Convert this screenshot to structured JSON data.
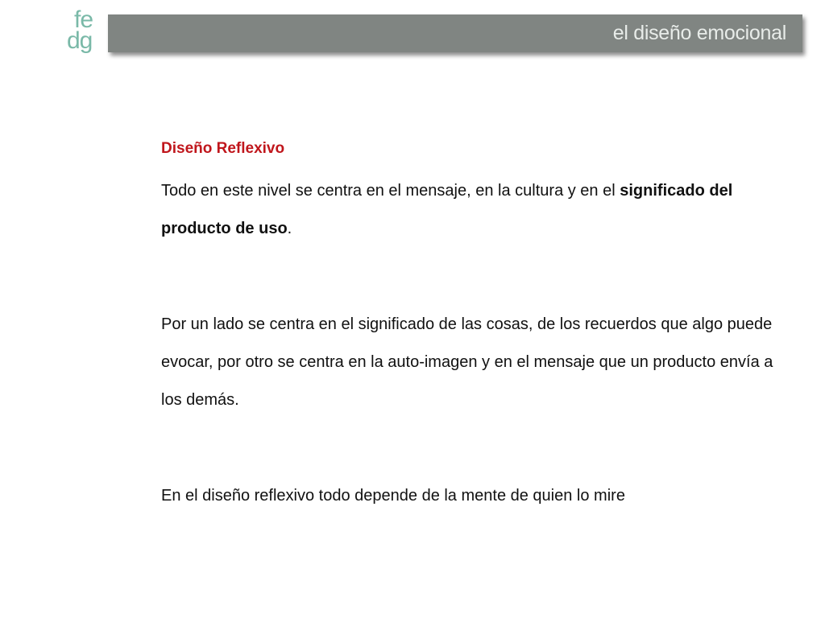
{
  "logo": {
    "line1": "fe",
    "line2": "dg"
  },
  "header": {
    "title": "el diseño emocional"
  },
  "content": {
    "heading": "Diseño Reflexivo",
    "paragraph1_text": "Todo en este nivel se centra en el mensaje, en la cultura y en el ",
    "paragraph1_bold": "significado del producto de uso",
    "paragraph1_end": ".",
    "paragraph2": "Por un lado se centra en el significado de las cosas, de los recuerdos que algo puede evocar, por otro se centra en la auto-imagen y en el mensaje que un producto envía a los demás.",
    "paragraph3": "En el diseño reflexivo todo depende de la mente de quien lo mire"
  },
  "colors": {
    "logo": "#7ab9a8",
    "header_bar": "#808582",
    "heading": "#c0161c"
  }
}
